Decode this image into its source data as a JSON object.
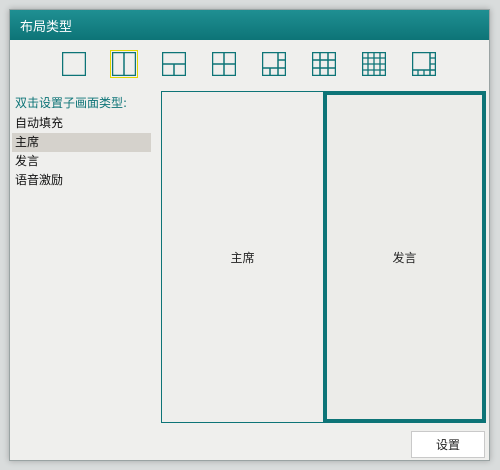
{
  "window": {
    "title": "布局类型"
  },
  "layout_buttons": [
    {
      "icon": "layout-1x1-icon",
      "selected": false
    },
    {
      "icon": "layout-2col-icon",
      "selected": true
    },
    {
      "icon": "layout-1top-2bottom-icon",
      "selected": false
    },
    {
      "icon": "layout-2x2-icon",
      "selected": false
    },
    {
      "icon": "layout-1plus5-icon",
      "selected": false
    },
    {
      "icon": "layout-3x3-icon",
      "selected": false
    },
    {
      "icon": "layout-4x4-icon",
      "selected": false
    },
    {
      "icon": "layout-1plus7-icon",
      "selected": false
    }
  ],
  "sidebar": {
    "label": "双击设置子画面类型:",
    "items": [
      {
        "label": "自动填充",
        "active": false
      },
      {
        "label": "主席",
        "active": true
      },
      {
        "label": "发言",
        "active": false
      },
      {
        "label": "语音激励",
        "active": false
      }
    ]
  },
  "preview": {
    "cells": [
      {
        "label": "主席",
        "selected": false
      },
      {
        "label": "发言",
        "selected": true
      }
    ]
  },
  "footer": {
    "set_button": "设置"
  },
  "colors": {
    "accent": "#0d7477",
    "selected_outline": "#e0d600"
  }
}
